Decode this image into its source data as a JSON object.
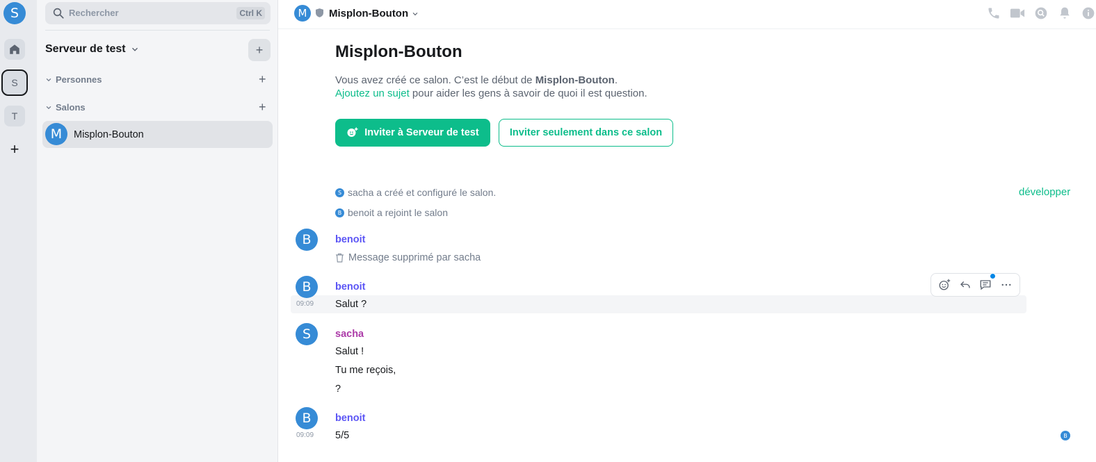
{
  "spacebar": {
    "user_initial": "S",
    "spaces": [
      {
        "name": "home",
        "label": ""
      },
      {
        "name": "S",
        "label": "S"
      },
      {
        "name": "T",
        "label": "T"
      }
    ],
    "add_label": "+"
  },
  "roomlist": {
    "search_placeholder": "Rechercher",
    "search_shortcut": "Ctrl K",
    "server_name": "Serveur de test",
    "sections": [
      {
        "label": "Personnes"
      },
      {
        "label": "Salons"
      }
    ],
    "rooms": [
      {
        "initial": "M",
        "name": "Misplon-Bouton"
      }
    ]
  },
  "header": {
    "avatar_initial": "M",
    "room_name": "Misplon-Bouton"
  },
  "intro": {
    "heading": "Misplon-Bouton",
    "line1_prefix": "Vous avez créé ce salon. C’est le début de ",
    "line1_room": "Misplon-Bouton",
    "line1_suffix": ".",
    "topic_link": "Ajoutez un sujet",
    "line2_suffix": " pour aider les gens à savoir de quoi il est question.",
    "invite_space_button": "Inviter à Serveur de test",
    "invite_room_button": "Inviter seulement dans ce salon"
  },
  "events": {
    "created": {
      "initial": "S",
      "text": "sacha a créé et configuré le salon."
    },
    "joined": {
      "initial": "B",
      "text": "benoit a rejoint le salon"
    },
    "expand_label": "développer"
  },
  "messages": [
    {
      "sender": "benoit",
      "initial": "B",
      "deleted_text": "Message supprimé par sacha"
    },
    {
      "sender": "benoit",
      "initial": "B",
      "time": "09:09",
      "lines": [
        "Salut ?"
      ]
    },
    {
      "sender": "sacha",
      "initial": "S",
      "lines": [
        "Salut !",
        "Tu me reçois,",
        "?"
      ]
    },
    {
      "sender": "benoit",
      "initial": "B",
      "time": "09:09",
      "lines": [
        "5/5"
      ]
    }
  ],
  "read_receipt_initial": "B",
  "colors": {
    "accent": "#0dbd8b",
    "avatar": "#368bd6",
    "benoit": "#5c56f5",
    "sacha": "#ac3ba8"
  }
}
